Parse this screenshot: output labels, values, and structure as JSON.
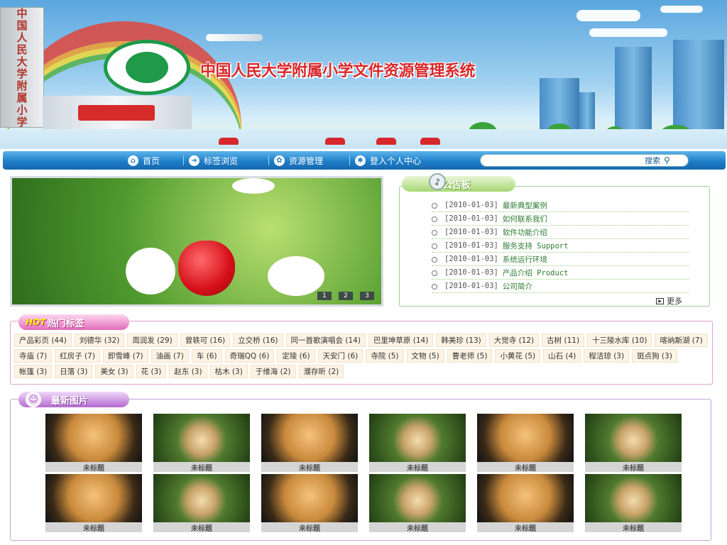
{
  "header": {
    "pillar_text": [
      "中",
      "国",
      "人",
      "民",
      "大",
      "学",
      "附",
      "属",
      "小",
      "学"
    ],
    "site_title": "中国人民大学附属小学文件资源管理系统"
  },
  "nav": {
    "items": [
      {
        "label": "首页",
        "icon": "home-icon"
      },
      {
        "label": "标签浏览",
        "icon": "tag-icon"
      },
      {
        "label": "资源管理",
        "icon": "folder-icon"
      },
      {
        "label": "登入个人中心",
        "icon": "user-icon"
      }
    ],
    "search_label": "搜索",
    "search_icon": "search-icon"
  },
  "slideshow": {
    "dots": [
      "1",
      "2",
      "3"
    ]
  },
  "notice": {
    "title": "公告板",
    "items": [
      {
        "date": "[2010-01-03]",
        "title": "最新典型案例"
      },
      {
        "date": "[2010-01-03]",
        "title": "如何联系我们"
      },
      {
        "date": "[2010-01-03]",
        "title": "软件功能介绍"
      },
      {
        "date": "[2010-01-03]",
        "title": "服务支持 Support"
      },
      {
        "date": "[2010-01-03]",
        "title": "系统运行环境"
      },
      {
        "date": "[2010-01-03]",
        "title": "产品介绍 Product"
      },
      {
        "date": "[2010-01-03]",
        "title": "公司简介"
      }
    ],
    "more": "更多"
  },
  "tags": {
    "hot": "HOT",
    "title": "热门标签",
    "items": [
      "产品彩页 (44)",
      "刘德华 (32)",
      "周润发 (29)",
      "曾轶可 (16)",
      "立交桥 (16)",
      "同一首歌演唱会 (14)",
      "巴里坤草原 (14)",
      "韩美珍 (13)",
      "大觉寺 (12)",
      "古树 (11)",
      "十三陵水库 (10)",
      "喀纳斯湖 (7)",
      "寺庙 (7)",
      "红房子 (7)",
      "即雪峰 (7)",
      "油画 (7)",
      "车 (6)",
      "奇瑞QQ (6)",
      "定陵 (6)",
      "天安门 (6)",
      "寺院 (5)",
      "文物 (5)",
      "曹老师 (5)",
      "小黄花 (5)",
      "山石 (4)",
      "程洁琼 (3)",
      "斑点狗 (3)",
      "帐篷 (3)",
      "日落 (3)",
      "美女 (3)",
      "花 (3)",
      "赵东 (3)",
      "枯木 (3)",
      "于维海 (2)",
      "濮存昕 (2)"
    ]
  },
  "pictures": {
    "title": "最新图片",
    "items": [
      {
        "caption": "未标题",
        "kind": "cat"
      },
      {
        "caption": "未标题",
        "kind": "chick"
      },
      {
        "caption": "未标题",
        "kind": "cat"
      },
      {
        "caption": "未标题",
        "kind": "chick"
      },
      {
        "caption": "未标题",
        "kind": "cat"
      },
      {
        "caption": "未标题",
        "kind": "chick"
      },
      {
        "caption": "未标题",
        "kind": "cat"
      },
      {
        "caption": "未标题",
        "kind": "chick"
      },
      {
        "caption": "未标题",
        "kind": "cat"
      },
      {
        "caption": "未标题",
        "kind": "chick"
      },
      {
        "caption": "未标题",
        "kind": "cat"
      },
      {
        "caption": "未标题",
        "kind": "chick"
      }
    ]
  }
}
